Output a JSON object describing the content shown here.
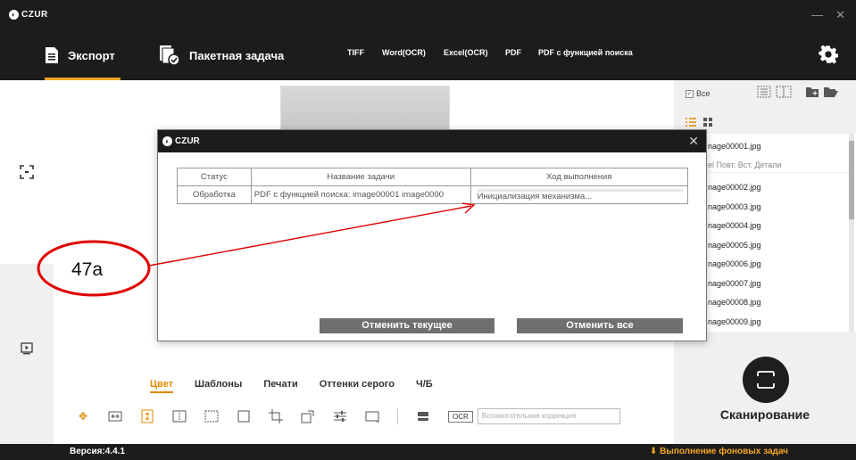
{
  "app": {
    "brand": "CZUR",
    "minimize": "—",
    "close": "✕"
  },
  "toolbar": {
    "export_label": "Экспорт",
    "batch_label": "Пакетная задача",
    "formats": [
      "TIFF",
      "Word(OCR)",
      "Excel(OCR)",
      "PDF",
      "PDF с функцией поиска"
    ],
    "accent": "#f5a623"
  },
  "right_panel": {
    "select_all": "Все",
    "files": [
      "nage00001.jpg",
      "nage00002.jpg",
      "nage00003.jpg",
      "nage00004.jpg",
      "nage00005.jpg",
      "nage00006.jpg",
      "nage00007.jpg",
      "nage00008.jpg",
      "nage00009.jpg"
    ],
    "file_actions": "el  Повт.  Вст.  Детали",
    "scan_label": "Сканирование"
  },
  "bottom": {
    "tabs": [
      "Цвет",
      "Шаблоны",
      "Печати",
      "Оттенки серого",
      "Ч/Б"
    ],
    "ocr": "OCR",
    "aux_correction": "Вспомогательная коррекция"
  },
  "status": {
    "version": "Версия:4.4.1",
    "background_tasks": "Выполнение фоновых задач"
  },
  "dialog": {
    "brand": "CZUR",
    "close": "✕",
    "headers": [
      "Статус",
      "Название задачи",
      "Ход выполнения"
    ],
    "row": {
      "status": "Обработка",
      "task": "PDF с функцией поиска: image00001  image0000",
      "progress_text": "Инициализация механизма...",
      "progress": 0.0
    },
    "cancel_current": "Отменить текущее",
    "cancel_all": "Отменить все"
  },
  "annotation": {
    "label": "47a",
    "color": "#e00000"
  }
}
